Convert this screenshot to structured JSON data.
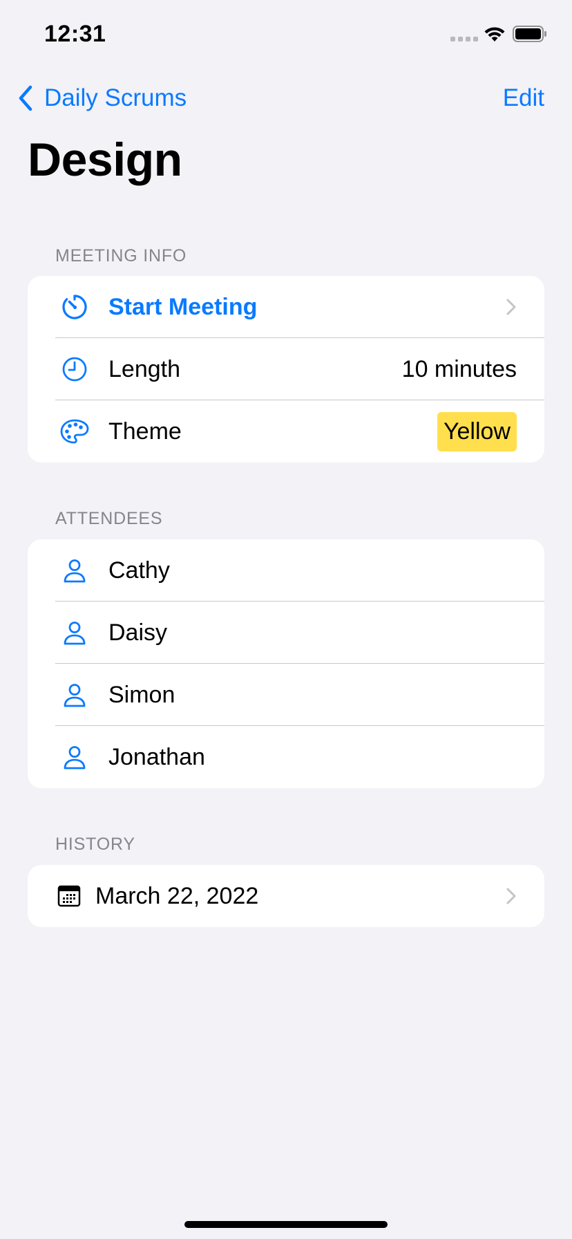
{
  "status_bar": {
    "time": "12:31"
  },
  "nav": {
    "back_label": "Daily Scrums",
    "edit_label": "Edit"
  },
  "page": {
    "title": "Design"
  },
  "meeting_info": {
    "header": "MEETING INFO",
    "start_meeting_label": "Start Meeting",
    "length_label": "Length",
    "length_value": "10 minutes",
    "theme_label": "Theme",
    "theme_value": "Yellow",
    "theme_color": "#ffdf4d"
  },
  "attendees": {
    "header": "ATTENDEES",
    "items": [
      {
        "name": "Cathy",
        "icon": "person-icon"
      },
      {
        "name": "Daisy",
        "icon": "person-icon"
      },
      {
        "name": "Simon",
        "icon": "person-icon"
      },
      {
        "name": "Jonathan",
        "icon": "person-icon"
      }
    ]
  },
  "history": {
    "header": "HISTORY",
    "items": [
      {
        "date": "March 22, 2022",
        "icon": "calendar-icon"
      }
    ]
  },
  "colors": {
    "accent": "#0a7aff",
    "background": "#f2f2f7",
    "card": "#ffffff"
  }
}
